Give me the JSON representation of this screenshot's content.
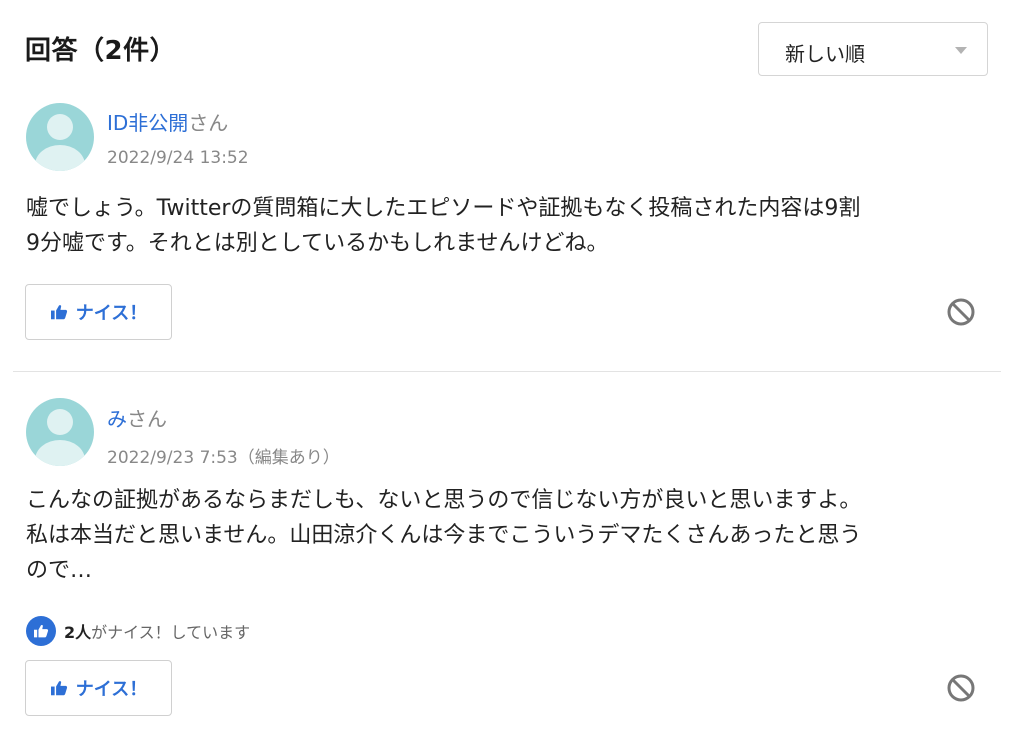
{
  "header": {
    "title": "回答（2件）",
    "sort_value": "新しい順"
  },
  "answers": [
    {
      "author_name": "ID非公開",
      "author_suffix": "さん",
      "date": "2022/9/24 13:52",
      "body_lines": [
        "嘘でしょう。Twitterの質問箱に大したエピソードや証拠もなく投稿された内容は9割",
        "9分嘘です。それとは別としているかもしれませんけどね。"
      ],
      "nice_label": "ナイス！"
    },
    {
      "author_name": "み",
      "author_suffix": "さん",
      "date": "2022/9/23 7:53（編集あり）",
      "body_lines": [
        "こんなの証拠があるならまだしも、ないと思うので信じない方が良いと思いますよ。",
        "私は本当だと思いません。山田涼介くんは今までこういうデマたくさんあったと思う",
        "ので…"
      ],
      "nice_count": "2人",
      "nice_summary_text": "がナイス！しています",
      "nice_label": "ナイス！"
    }
  ],
  "colors": {
    "accent": "#2d6fd6",
    "avatar_bg": "#9ad6d8",
    "muted_text": "#888888"
  },
  "icons": {
    "sort_caret": "chevron-down-icon",
    "nice": "thumbs-up-icon",
    "report": "prohibit-icon",
    "avatar": "user-silhouette-icon"
  }
}
